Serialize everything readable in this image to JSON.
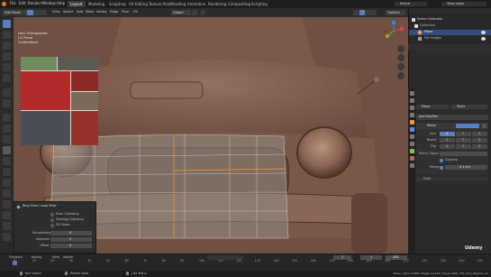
{
  "menu": [
    "File",
    "Edit",
    "Render",
    "Window",
    "Help"
  ],
  "workspaces": [
    "Layout",
    "Modeling",
    "Sculpting",
    "UV Editing",
    "Texture Paint",
    "Shading",
    "Animation",
    "Rendering",
    "Compositing",
    "Scripting"
  ],
  "active_workspace": "Layout",
  "scene": "Scene",
  "view_layer": "View Layer",
  "header": {
    "mode": "Edit Mode",
    "menus": [
      "View",
      "Select",
      "Add",
      "Mesh",
      "Vertex",
      "Edge",
      "Face",
      "UV"
    ],
    "transform": "Global",
    "overlay_right": "Options"
  },
  "viewport": {
    "projection": "User Orthographic",
    "info_line": "(1) Plane",
    "units": "Centimeters"
  },
  "operator_panel": {
    "title": "Ring Slice / Loop Slide",
    "rows": [
      "Even Clamping",
      "Topology Distance",
      "Fill Sharp"
    ],
    "fields": [
      {
        "label": "Smoothness",
        "value": "0"
      },
      {
        "label": "Selected",
        "value": "1"
      },
      {
        "label": "Offset",
        "value": "0"
      }
    ]
  },
  "outliner": {
    "title": "Scene Collection",
    "items": [
      "Collection",
      "Plane",
      "Ref Images"
    ]
  },
  "properties": {
    "object_name": "Plane",
    "data_name": "Plane",
    "add_modifier": "Add Modifier",
    "modifier_name": "Mirror",
    "axis_label": "Axis",
    "bisect_label": "Bisect",
    "flip_label": "Flip",
    "axes": [
      "X",
      "Y",
      "Z"
    ],
    "mirror_object_label": "Mirror Object",
    "clipping_label": "Clipping",
    "merge_label": "Merge",
    "merge_value": "0.1 cm",
    "data_label": "Data"
  },
  "timeline": {
    "menus": [
      "Playback",
      "Keying",
      "View",
      "Marker"
    ],
    "current_frame": "1",
    "start": "1",
    "end": "250",
    "ticks": [
      "0",
      "10",
      "20",
      "30",
      "40",
      "50",
      "60",
      "70",
      "80",
      "90",
      "100",
      "110",
      "120",
      "130",
      "140",
      "150",
      "160",
      "170",
      "180",
      "190",
      "200",
      "210",
      "220",
      "230",
      "240",
      "250"
    ]
  },
  "status": {
    "left": "Box Select",
    "middle": "Rotate View",
    "context": "Call Menu",
    "right": "Plane | Verts 37/88 | Edges 12/145 | Faces 0/58 | Tris 114 | Objects 1/2"
  },
  "watermark": "Udemy"
}
